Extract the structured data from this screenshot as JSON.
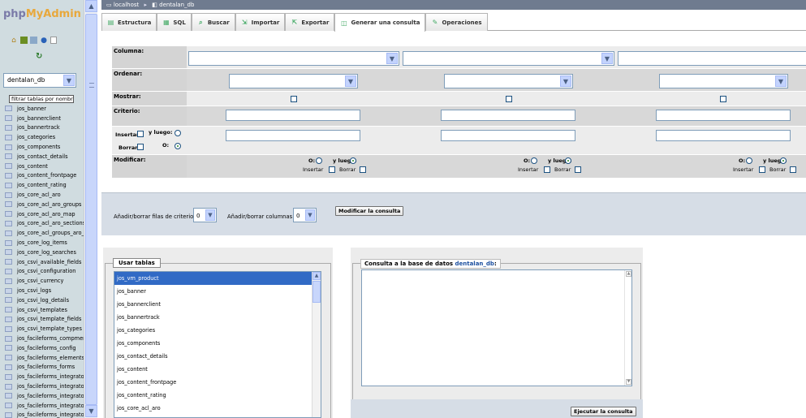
{
  "left": {
    "logo": {
      "php": "php",
      "myadmin": "MyAdmin"
    },
    "icons": [
      "home-icon",
      "sql-icon",
      "query-window-icon",
      "docs-icon",
      "info-icon"
    ],
    "db_selected": "dentalan_db",
    "filter_placeholder": "filtrar tablas por nombre",
    "tables": [
      "jos_banner",
      "jos_bannerclient",
      "jos_bannertrack",
      "jos_categories",
      "jos_components",
      "jos_contact_details",
      "jos_content",
      "jos_content_frontpage",
      "jos_content_rating",
      "jos_core_acl_aro",
      "jos_core_acl_aro_groups",
      "jos_core_acl_aro_map",
      "jos_core_acl_aro_sections",
      "jos_core_acl_groups_aro_map",
      "jos_core_log_items",
      "jos_core_log_searches",
      "jos_csvi_available_fields",
      "jos_csvi_configuration",
      "jos_csvi_currency",
      "jos_csvi_logs",
      "jos_csvi_log_details",
      "jos_csvi_templates",
      "jos_csvi_template_fields",
      "jos_csvi_template_types",
      "jos_facileforms_compmenus",
      "jos_facileforms_config",
      "jos_facileforms_elements",
      "jos_facileforms_forms",
      "jos_facileforms_integrator",
      "jos_facileforms_integrator",
      "jos_facileforms_integrator",
      "jos_facileforms_integrator",
      "jos_facileforms_integrator"
    ]
  },
  "breadcrumb": {
    "server": "localhost",
    "database": "dentalan_db"
  },
  "tabs": [
    {
      "label": "Estructura",
      "icon": "structure-icon"
    },
    {
      "label": "SQL",
      "icon": "sql-icon"
    },
    {
      "label": "Buscar",
      "icon": "search-icon"
    },
    {
      "label": "Importar",
      "icon": "import-icon"
    },
    {
      "label": "Exportar",
      "icon": "export-icon"
    },
    {
      "label": "Generar una consulta",
      "icon": "query-icon",
      "active": true
    },
    {
      "label": "Operaciones",
      "icon": "wrench-icon"
    }
  ],
  "grid": {
    "column_label": "Columna:",
    "order_label": "Ordenar:",
    "show_label": "Mostrar:",
    "criteria_label": "Criterio:",
    "modify_label": "Modificar:",
    "insert_label": "Insertar:",
    "delete_label": "Borrar:",
    "and_label": "y luego:",
    "or_label": "O:",
    "insert_col": "Insertar",
    "delete_col": "Borrar"
  },
  "rows_panel": {
    "rows_label": "Añadir/borrar filas de criterio:",
    "rows_value": "0",
    "cols_label": "Añadir/borrar columnas:",
    "cols_value": "0",
    "update_button": "Modificar la consulta"
  },
  "use_tables": {
    "legend": "Usar tablas",
    "options": [
      "jos_vm_product",
      "jos_banner",
      "jos_bannerclient",
      "jos_bannertrack",
      "jos_categories",
      "jos_components",
      "jos_contact_details",
      "jos_content",
      "jos_content_frontpage",
      "jos_content_rating",
      "jos_core_acl_aro"
    ]
  },
  "query_panel": {
    "legend_prefix": "Consulta a la base de datos",
    "legend_db": "dentalan_db",
    "legend_suffix": ":",
    "submit_button": "Ejecutar la consulta"
  }
}
